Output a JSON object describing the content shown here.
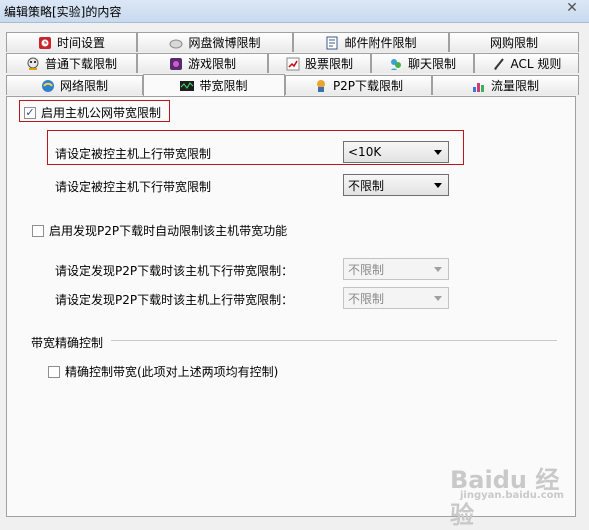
{
  "window": {
    "title": "编辑策略[实验]的内容",
    "close_glyph": "✕"
  },
  "tabs_row1": [
    {
      "label": "时间设置",
      "icon": "time-icon"
    },
    {
      "label": "网盘微博限制",
      "icon": "cloud-icon"
    },
    {
      "label": "邮件附件限制",
      "icon": "attachment-icon"
    },
    {
      "label": "网购限制",
      "icon": ""
    }
  ],
  "tabs_row2": [
    {
      "label": "普通下载限制",
      "icon": "download-icon"
    },
    {
      "label": "游戏限制",
      "icon": "game-icon"
    },
    {
      "label": "股票限制",
      "icon": "stock-icon"
    },
    {
      "label": "聊天限制",
      "icon": "chat-icon"
    },
    {
      "label": "ACL 规则",
      "icon": "acl-icon"
    }
  ],
  "tabs_row3": [
    {
      "label": "网络限制",
      "icon": "network-icon"
    },
    {
      "label": "带宽限制",
      "icon": "bandwidth-icon",
      "active": true
    },
    {
      "label": "P2P下载限制",
      "icon": "p2p-icon"
    },
    {
      "label": "流量限制",
      "icon": "traffic-icon"
    }
  ],
  "bandwidth": {
    "enable_label": "启用主机公网带宽限制",
    "enable_checked": true,
    "upload_label": "请设定被控主机上行带宽限制",
    "upload_value": "<10K",
    "download_label": "请设定被控主机下行带宽限制",
    "download_value": "不限制"
  },
  "p2p": {
    "enable_label": "启用发现P2P下载时自动限制该主机带宽功能",
    "enable_checked": false,
    "download_label": "请设定发现P2P下载时该主机下行带宽限制：",
    "download_value": "不限制",
    "upload_label": "请设定发现P2P下载时该主机上行带宽限制：",
    "upload_value": "不限制"
  },
  "precise": {
    "group_title": "带宽精确控制",
    "checkbox_label": "精确控制带宽(此项对上述两项均有控制)",
    "checked": false
  },
  "watermark": {
    "text": "Baidu 经验",
    "subtext": "jingyan.baidu.com"
  }
}
